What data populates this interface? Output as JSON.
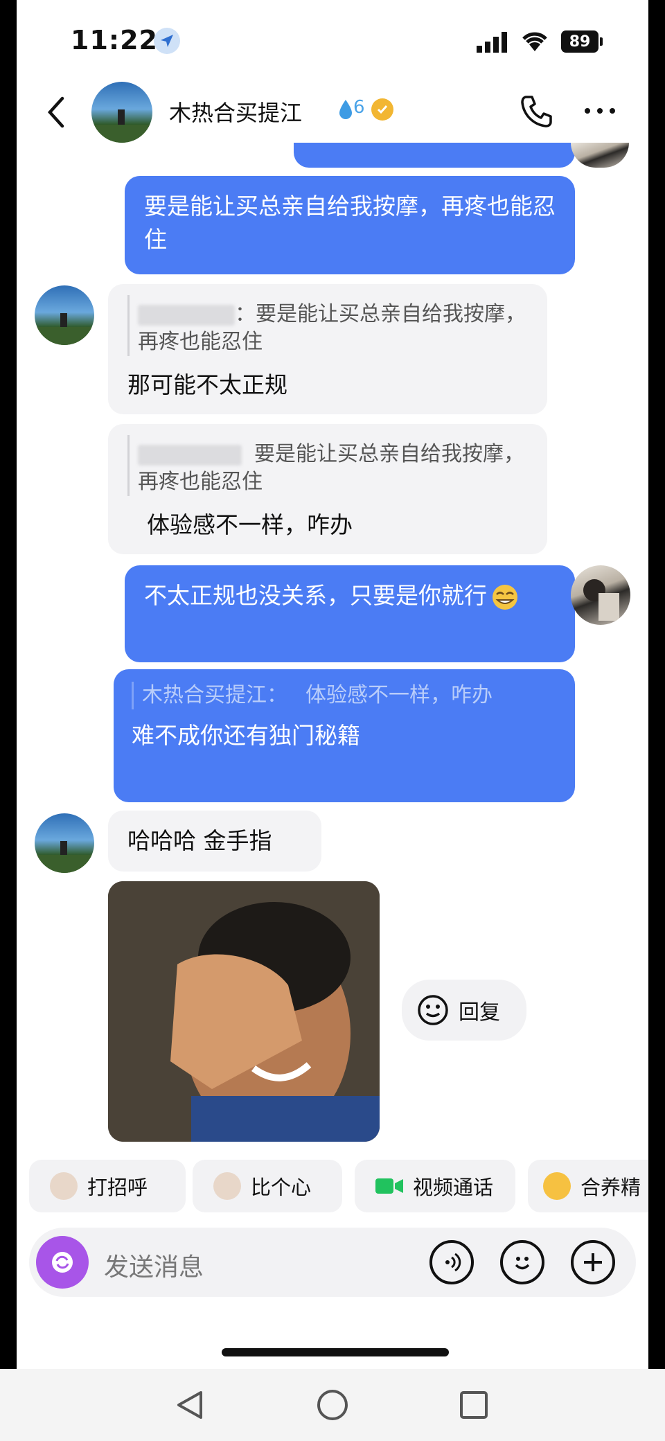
{
  "status": {
    "time": "11:22",
    "battery": "89"
  },
  "header": {
    "title": "木热合买提江",
    "level": "6"
  },
  "messages": [
    {
      "from": "me",
      "text": "要是能让买总亲自给我按摩，再疼也能忍住"
    },
    {
      "from": "them",
      "quote_sep": "：",
      "quote": "要是能让买总亲自给我按摩，再疼也能忍住",
      "text": "那可能不太正规"
    },
    {
      "from": "them",
      "quote": "要是能让买总亲自给我按摩，再疼也能忍住",
      "text": "体验感不一样，咋办"
    },
    {
      "from": "me",
      "text": "不太正规也没关系，只要是你就行"
    },
    {
      "from": "me",
      "quote_author": "木热合买提江：",
      "quote": "体验感不一样，咋办",
      "text": "难不成你还有独门秘籍"
    },
    {
      "from": "them",
      "text": "哈哈哈 金手指"
    }
  ],
  "reply_button": "回复",
  "quick_actions": [
    "打招呼",
    "比个心",
    "视频通话",
    "合养精"
  ],
  "input": {
    "placeholder": "发送消息"
  },
  "colors": {
    "accent": "#4b7cf4",
    "camera": "#a855e8"
  }
}
